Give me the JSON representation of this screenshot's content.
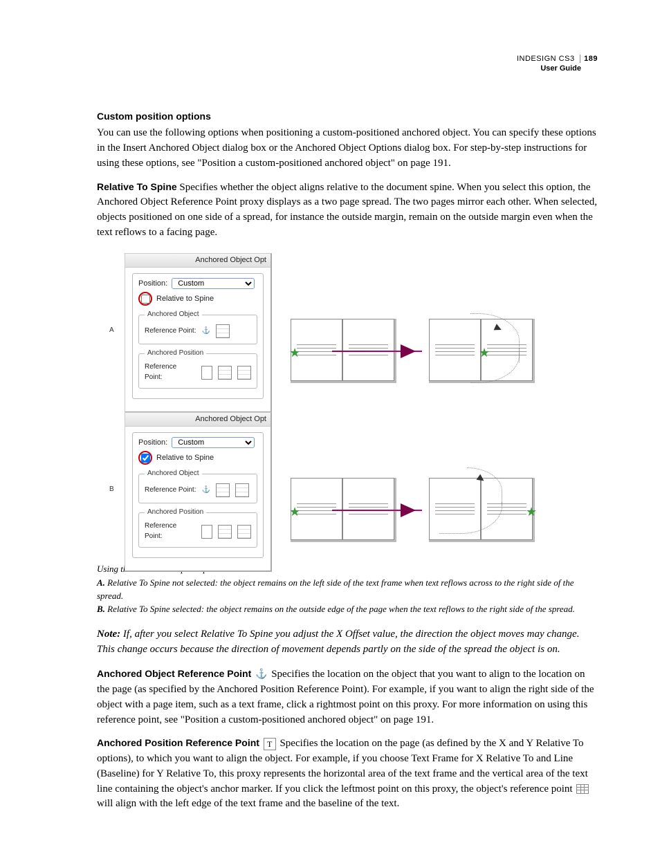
{
  "header": {
    "product": "INDESIGN CS3",
    "pagenum": "189",
    "subtitle": "User Guide"
  },
  "section_title": "Custom position options",
  "intro": "You can use the following options when positioning a custom-positioned anchored object. You can specify these options in the Insert Anchored Object dialog box or the Anchored Object Options dialog box. For step-by-step instructions for using these options, see \"Position a custom-positioned anchored object\" on page 191.",
  "relspine": {
    "label": "Relative To Spine",
    "text": " Specifies whether the object aligns relative to the document spine. When you select this option, the Anchored Object Reference Point proxy displays as a two page spread. The two pages mirror each other. When selected, objects positioned on one side of a spread, for instance the outside margin, remain on the outside margin even when the text reflows to a facing page."
  },
  "dialog": {
    "title": "Anchored Object Opt",
    "position_label": "Position:",
    "position_value": "Custom",
    "relative_label": "Relative to Spine",
    "anchored_object_legend": "Anchored Object",
    "anchored_position_legend": "Anchored Position",
    "refpt_label": "Reference Point:"
  },
  "row_labels": {
    "a": "A",
    "b": "B"
  },
  "caption": {
    "title": "Using the Relative To Spine option",
    "a_label": "A.",
    "a_text": " Relative To Spine not selected: the object remains on the left side of the text frame when text reflows across to the right side of the spread.",
    "b_label": "B.",
    "b_text": " Relative To Spine selected: the object remains on the outside edge of the page when the text reflows to the right side of the spread."
  },
  "note": {
    "label": "Note:",
    "text": " If, after you select Relative To Spine you adjust the X Offset value, the direction the object moves may change. This change occurs because the direction of movement depends partly on the side of the spread the object is on."
  },
  "aorp": {
    "label": "Anchored Object Reference Point",
    "text": "  Specifies the location on the object that you want to align to the location on the page (as specified by the Anchored Position Reference Point). For example, if you want to align the right side of the object with a page item, such as a text frame, click a rightmost point on this proxy. For more information on using this reference point, see \"Position a custom-positioned anchored object\" on page 191."
  },
  "aprp": {
    "label": "Anchored Position Reference Point",
    "text_before_icon": "  Specifies the location on the page (as defined by the X and Y Relative To options), to which you want to align the object. For example, if you choose Text Frame for X Relative To and Line (Baseline) for Y Relative To, this proxy represents the horizontal area of the text frame and the vertical area of the text line containing the object's anchor marker. If you click the leftmost point on this proxy, the object's reference point ",
    "text_after_icon": " will align with the left edge of the text frame and the baseline of the text."
  }
}
